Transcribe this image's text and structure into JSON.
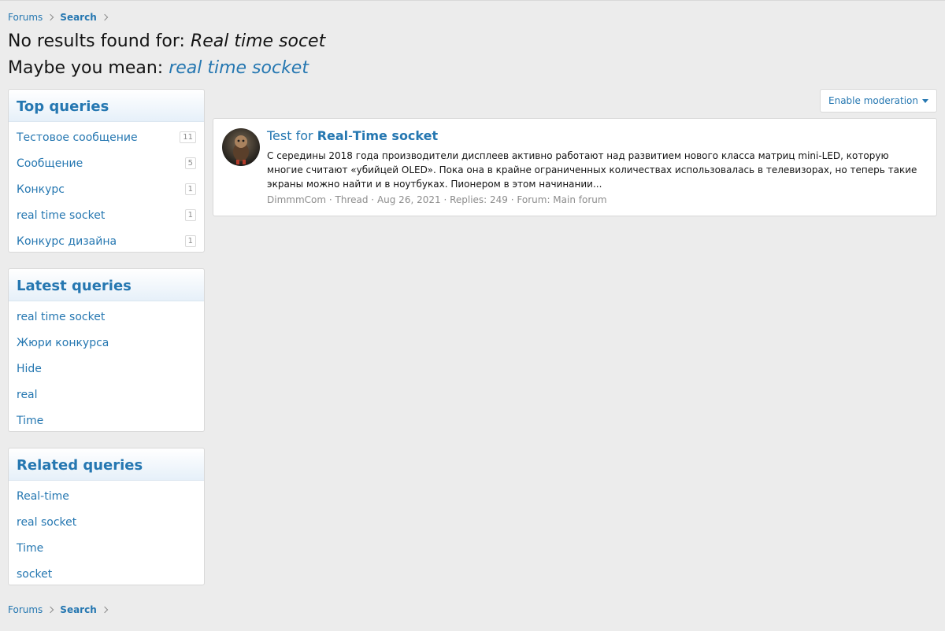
{
  "breadcrumb": {
    "items": [
      "Forums",
      "Search"
    ]
  },
  "search": {
    "no_results_prefix": "No results found for: ",
    "query": "Real time socet",
    "maybe_prefix": "Maybe you mean: ",
    "suggestion": "real time socket"
  },
  "moderation_button": {
    "label": "Enable moderation",
    "icon": "caret-down-icon"
  },
  "top_queries": {
    "title": "Top queries",
    "items": [
      {
        "label": "Тестовое сообщение",
        "count": "11"
      },
      {
        "label": "Сообщение",
        "count": "5"
      },
      {
        "label": "Конкурс",
        "count": "1"
      },
      {
        "label": "real time socket",
        "count": "1"
      },
      {
        "label": "Конкурс дизайна",
        "count": "1"
      }
    ]
  },
  "latest_queries": {
    "title": "Latest queries",
    "items": [
      "real time socket",
      "Жюри конкурса",
      "Hide",
      "real",
      "Time"
    ]
  },
  "related_queries": {
    "title": "Related queries",
    "items": [
      "Real-time",
      "real socket",
      "Time",
      "socket"
    ]
  },
  "result": {
    "title_prefix": "Test for ",
    "title_bold_1": "Real",
    "title_sep": "-",
    "title_bold_2": "Time socket",
    "snippet": "С середины 2018 года производители дисплеев активно работают над развитием нового класса матриц mini-LED, которую многие считают «убийцей OLED». Пока она в крайне ограниченных количествах использовалась в телевизорах, но теперь такие экраны можно найти и в ноутбуках. Пионером в этом начинании...",
    "author": "DimmmCom",
    "type": "Thread",
    "date": "Aug 26, 2021",
    "replies": "Replies: 249",
    "forum": "Forum: Main forum",
    "meta_sep": " · "
  },
  "colors": {
    "link": "#2577b1",
    "page_bg": "#ececec",
    "muted": "#8c8c8c"
  }
}
